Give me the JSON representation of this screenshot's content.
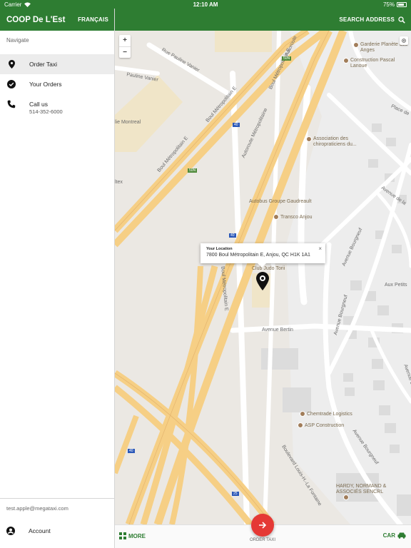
{
  "status_bar": {
    "carrier": "Carrier",
    "time": "12:10 AM",
    "battery": "75%",
    "battery_level": 0.75
  },
  "sidebar": {
    "brand": "COOP De L'Est",
    "language_button": "FRANÇAIS",
    "nav_heading": "Navigate",
    "items": [
      {
        "label": "Order Taxi",
        "icon": "location-pin-icon",
        "active": true
      },
      {
        "label": "Your Orders",
        "icon": "check-circle-icon"
      },
      {
        "label": "Call us",
        "sub": "514-352-6000",
        "icon": "phone-icon"
      }
    ],
    "user_email": "test.apple@megataxi.com",
    "account_label": "Account"
  },
  "header": {
    "search_label": "SEARCH ADDRESS"
  },
  "map": {
    "zoom_in": "+",
    "zoom_out": "−",
    "info_window": {
      "title": "Your Location",
      "address": "7800 Boul Métropolitain E, Anjou, QC H1K 1A1",
      "close": "×"
    },
    "street_labels": [
      "Rue Pauline Vanier",
      "Pauline Vanier",
      "Boul Métropolitain E",
      "Boul Métropolitain E",
      "Autoroute Métropolitaine",
      "Boul Métropolitain E",
      "Autoroute",
      "Boul Métropolitain E",
      "Avenue Bertin",
      "Avenue Bourgneuf",
      "Avenue Bourgneuf",
      "Avenue Bourgneuf",
      "Boulevard Louis-H.-La Fontaine",
      "Avenue Bodmer",
      "Place de",
      "Avenue de la",
      "Aux Petits",
      "lie Montreal",
      "ltex"
    ],
    "places": [
      "Garderie Planète des Anges",
      "Construction Pascal Lanoue",
      "Association des chiropraticiens du...",
      "Autobus Groupe Gaudreault",
      "Transco Anjou",
      "Club Judo Torii",
      "Chemtrade Logistics",
      "ASP Construction",
      "HARDY, NORMAND & ASSOCIÉS SENCRL"
    ],
    "route_shields": [
      "50N",
      "40",
      "50N",
      "40",
      "40",
      "25"
    ]
  },
  "bottom_bar": {
    "more_label": "MORE",
    "order_label": "ORDER TAXI",
    "car_label": "CAR"
  },
  "colors": {
    "primary": "#2e7d32",
    "fab": "#e53935",
    "highway": "#f6cf85",
    "map_bg": "#ebe8e3"
  }
}
